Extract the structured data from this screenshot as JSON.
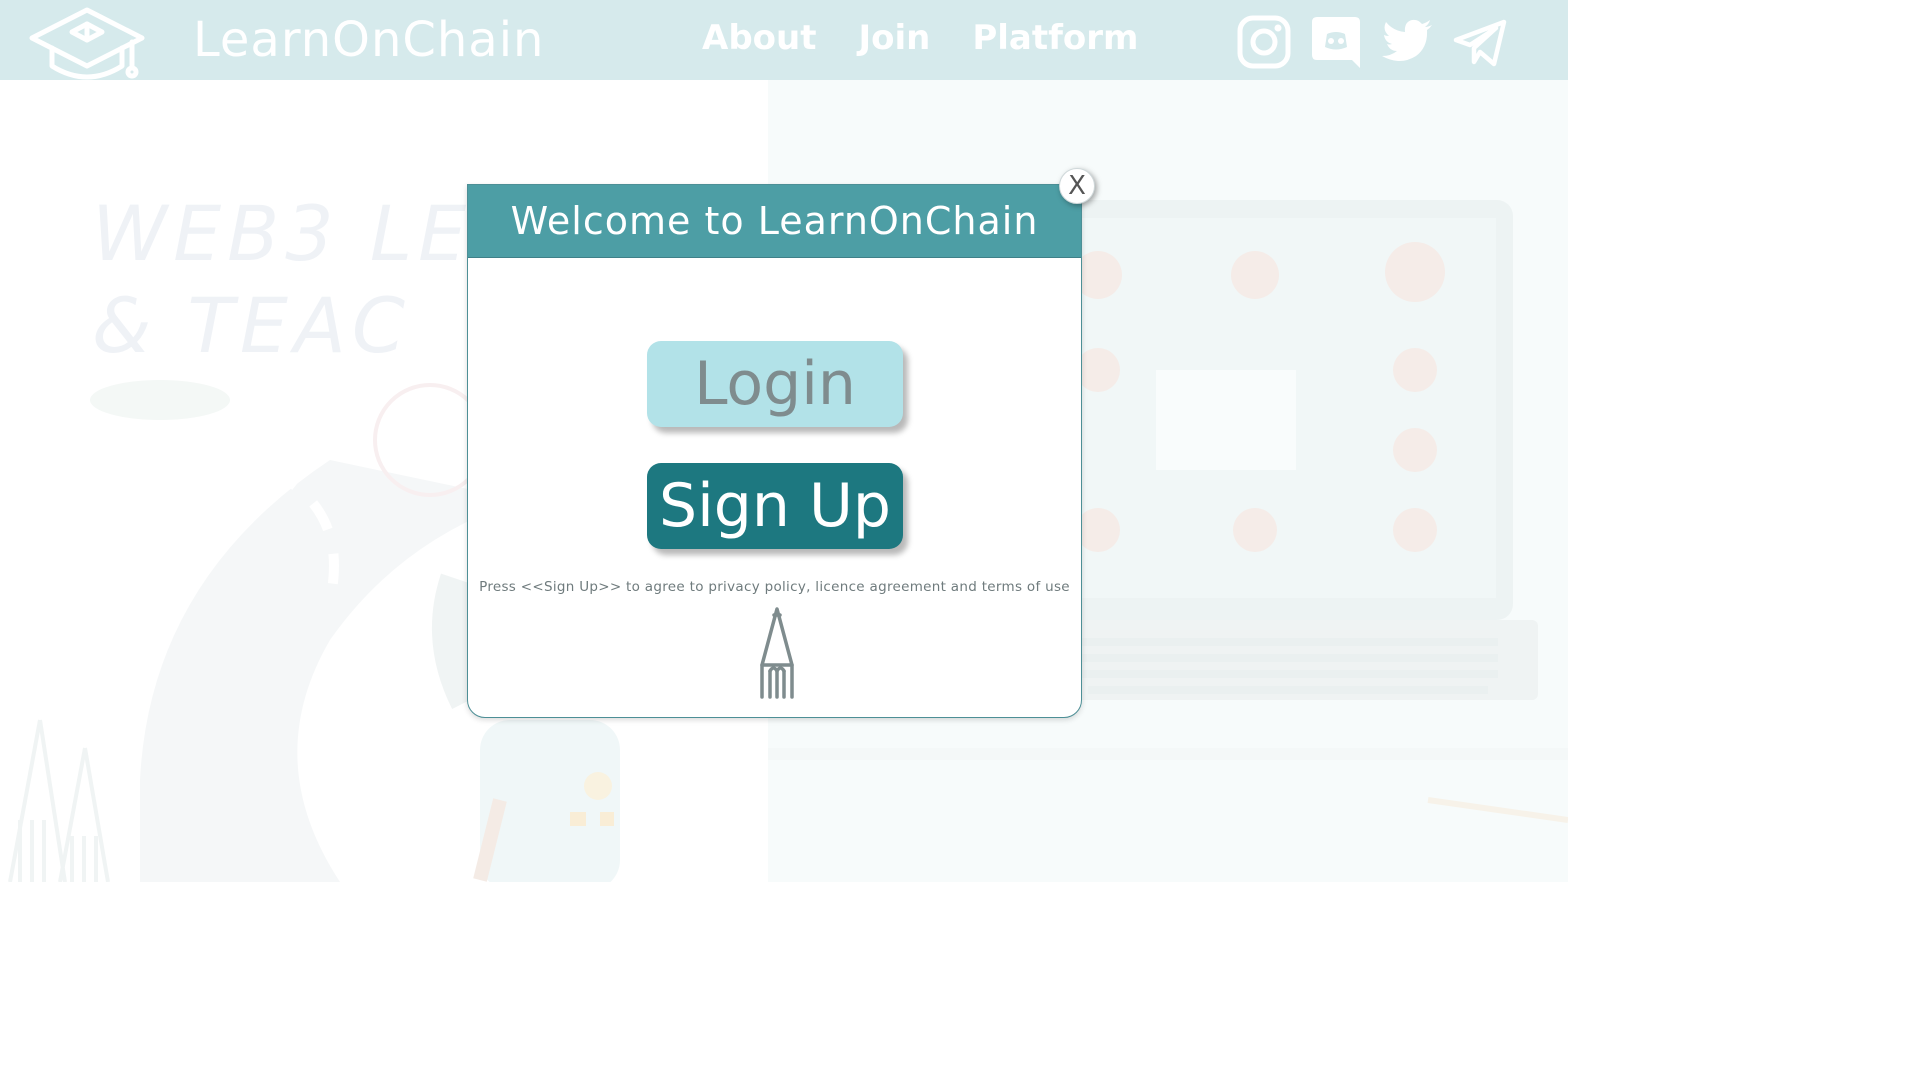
{
  "nav": {
    "brand": "LearnOnChain",
    "links": [
      "About",
      "Join",
      "Platform"
    ],
    "social_icons": [
      "instagram-icon",
      "discord-icon",
      "twitter-icon",
      "telegram-icon"
    ],
    "background_color": "#d6eaec"
  },
  "hero": {
    "title_line1": "WEB3 LEA",
    "title_line2": "& TEAC"
  },
  "modal": {
    "title": "Welcome to LearnOnChain",
    "close_label": "X",
    "login_label": "Login",
    "signup_label": "Sign Up",
    "terms_text": "Press <<Sign Up>> to agree to privacy policy, licence agreement and terms of use",
    "colors": {
      "header": "#4d9ea5",
      "login_bg": "#b2e2e8",
      "signup_bg": "#1d7880"
    }
  }
}
